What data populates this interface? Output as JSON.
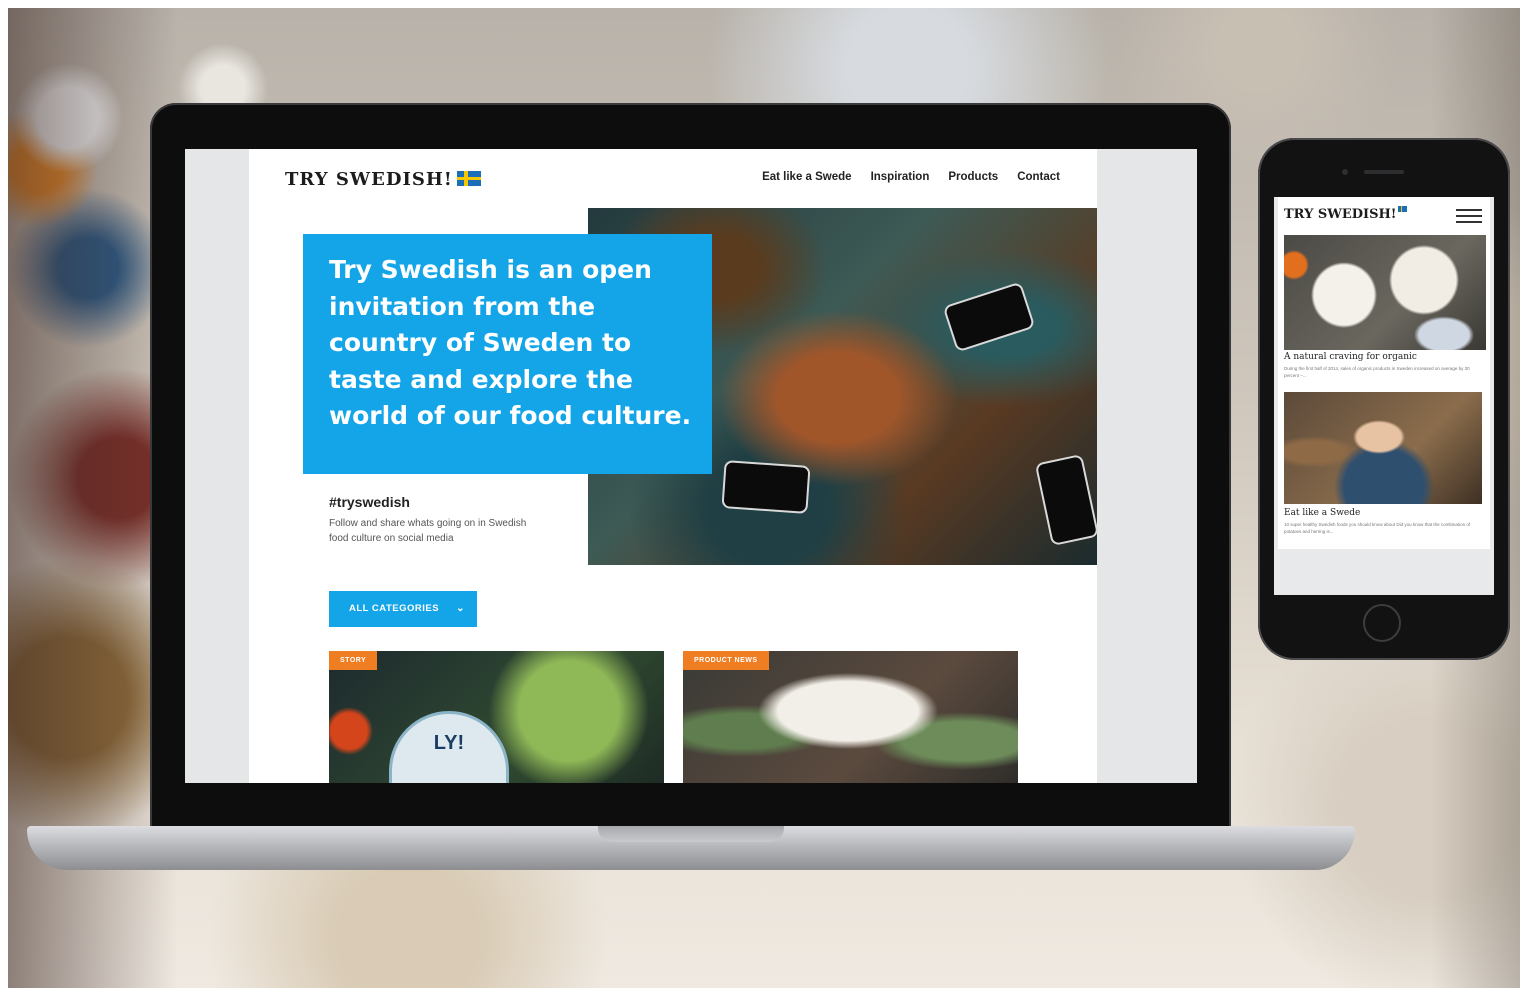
{
  "desktop": {
    "logo": "TRY SWEDISH!",
    "nav": [
      "Eat like a Swede",
      "Inspiration",
      "Products",
      "Contact"
    ],
    "hero_text": "Try Swedish is an open invitation from the country of Sweden to taste and explore the world of our food culture.",
    "social": {
      "title": "#tryswedish",
      "description": "Follow and share whats going on in Swedish food culture on social media"
    },
    "categories_button": "ALL CATEGORIES",
    "cards": [
      {
        "tag": "STORY",
        "image_text": "LY!"
      },
      {
        "tag": "PRODUCT NEWS"
      }
    ],
    "colors": {
      "accent": "#13a5e8",
      "tag": "#ef7d22"
    }
  },
  "mobile": {
    "logo": "TRY SWEDISH!",
    "menu_icon": "hamburger-icon",
    "articles": [
      {
        "title": "A natural craving for organic",
        "excerpt": "During the first half of 2014, sales of organic products in Sweden increased on average by 30 percent –..."
      },
      {
        "title": "Eat like a Swede",
        "excerpt": "10 super healthy Swedish foods you should know about Did you know that the combination of potatoes and herring is..."
      }
    ]
  }
}
